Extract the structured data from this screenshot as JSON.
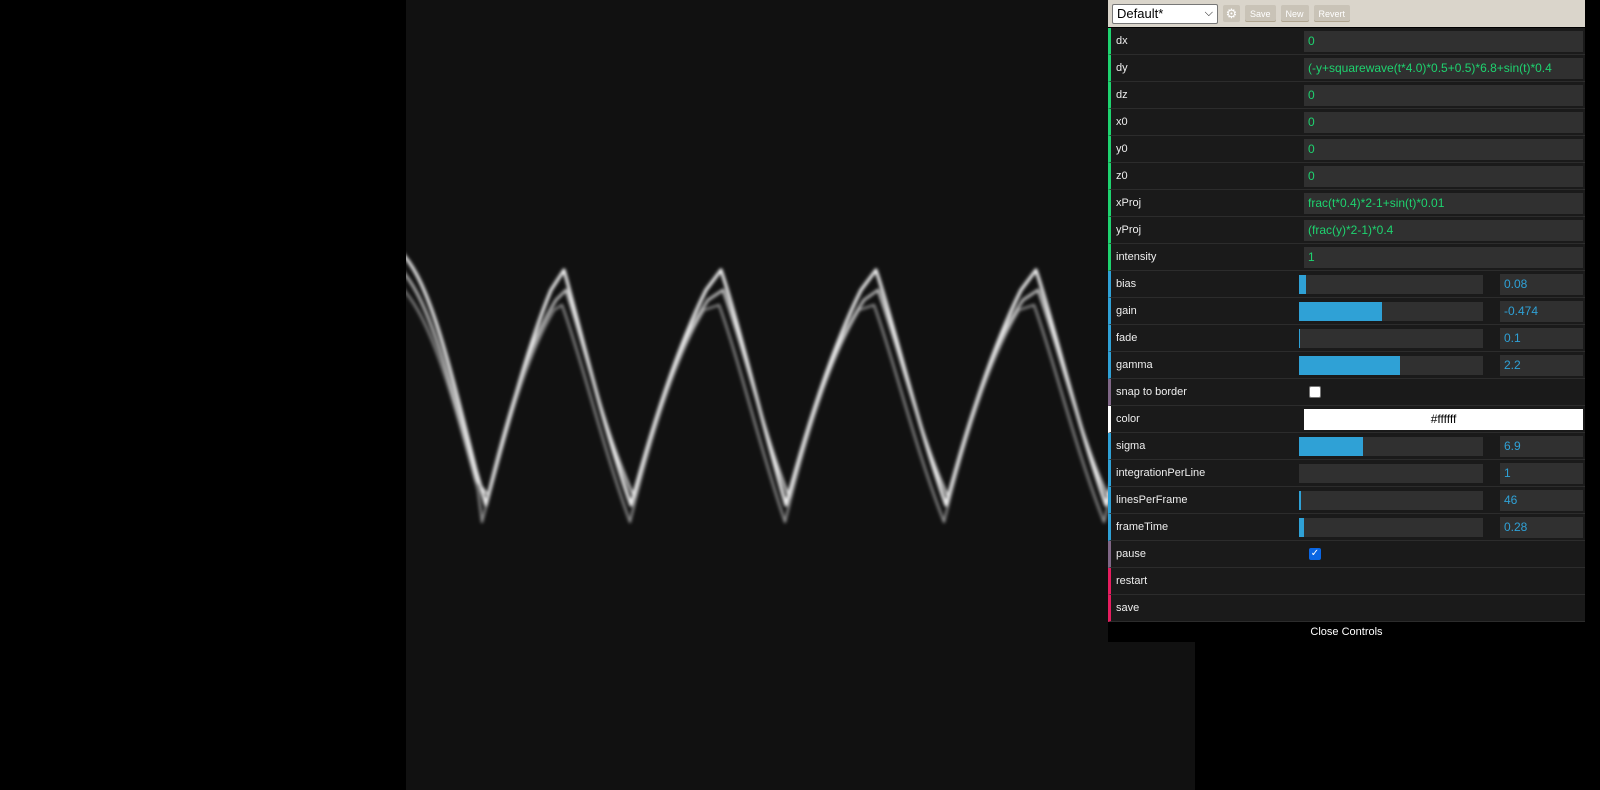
{
  "toolbar": {
    "preset": "Default*",
    "save_label": "Save",
    "new_label": "New",
    "revert_label": "Revert"
  },
  "controls": {
    "dx": {
      "label": "dx",
      "value": "0"
    },
    "dy": {
      "label": "dy",
      "value": "(-y+squarewave(t*4.0)*0.5+0.5)*6.8+sin(t)*0.4"
    },
    "dz": {
      "label": "dz",
      "value": "0"
    },
    "x0": {
      "label": "x0",
      "value": "0"
    },
    "y0": {
      "label": "y0",
      "value": "0"
    },
    "z0": {
      "label": "z0",
      "value": "0"
    },
    "xProj": {
      "label": "xProj",
      "value": "frac(t*0.4)*2-1+sin(t)*0.01"
    },
    "yProj": {
      "label": "yProj",
      "value": "(frac(y)*2-1)*0.4"
    },
    "intensity": {
      "label": "intensity",
      "value": "1"
    },
    "bias": {
      "label": "bias",
      "value": "0.08",
      "fill": 0.04
    },
    "gain": {
      "label": "gain",
      "value": "-0.474",
      "fill": 0.45
    },
    "fade": {
      "label": "fade",
      "value": "0.1",
      "fill": 0.005
    },
    "gamma": {
      "label": "gamma",
      "value": "2.2",
      "fill": 0.55
    },
    "snap": {
      "label": "snap to border",
      "checked": false
    },
    "color": {
      "label": "color",
      "value": "#ffffff"
    },
    "sigma": {
      "label": "sigma",
      "value": "6.9",
      "fill": 0.35
    },
    "integrationPerLine": {
      "label": "integrationPerLine",
      "value": "1",
      "fill": 0
    },
    "linesPerFrame": {
      "label": "linesPerFrame",
      "value": "46",
      "fill": 0.012
    },
    "frameTime": {
      "label": "frameTime",
      "value": "0.28",
      "fill": 0.025
    },
    "pause": {
      "label": "pause",
      "checked": true
    },
    "restart": {
      "label": "restart"
    },
    "save": {
      "label": "save"
    }
  },
  "close_label": "Close Controls",
  "colors": {
    "string_accent": "#1ed36f",
    "number_accent": "#2fa1d6",
    "bool_accent": "#806787",
    "function_accent": "#e61d5f",
    "canvas_bg": "#111111"
  }
}
